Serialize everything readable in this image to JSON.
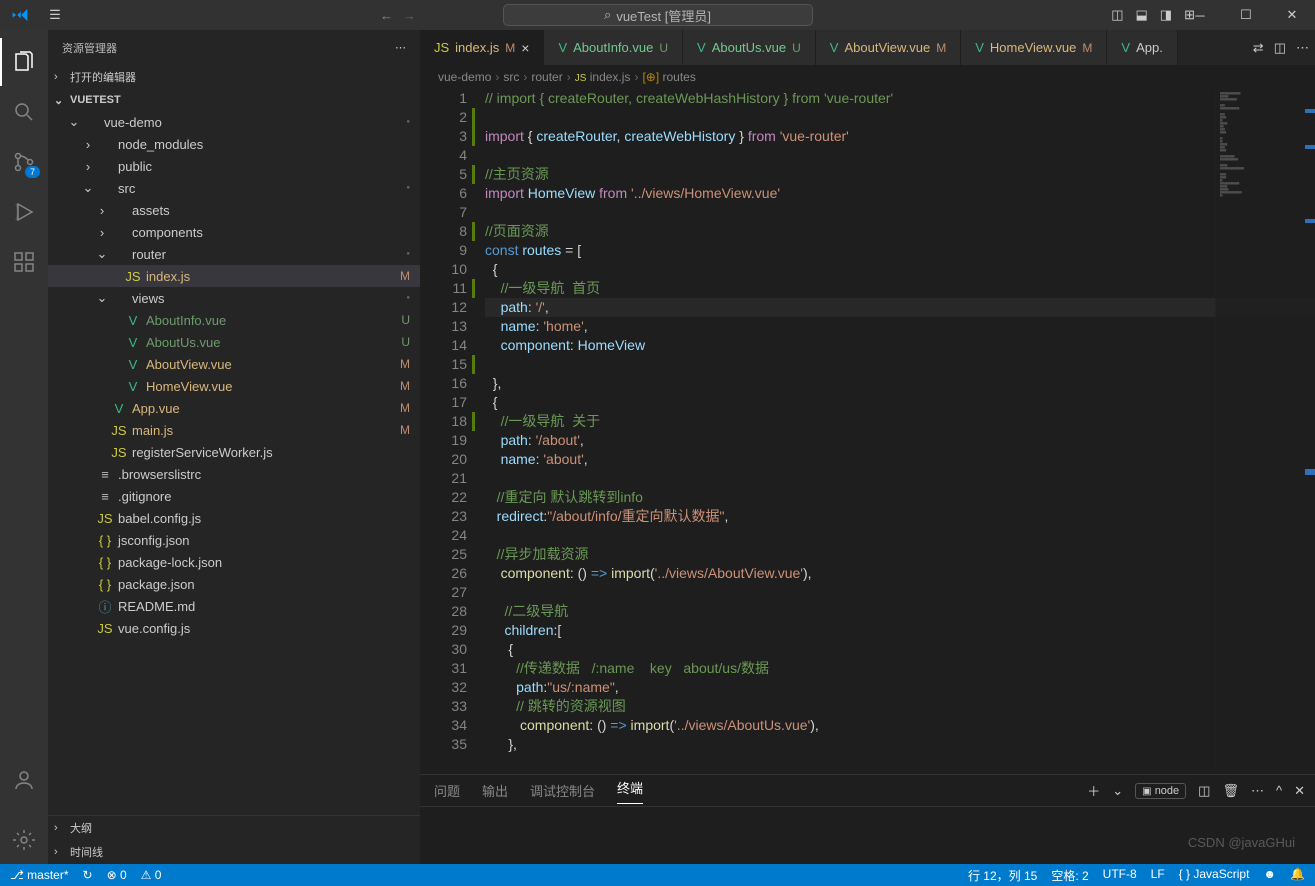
{
  "titlebar": {
    "search_prefix": "⌕",
    "search_text": "vueTest [管理员]"
  },
  "activity": {
    "scm_badge": "7"
  },
  "sidebar": {
    "title": "资源管理器",
    "open_editors": "打开的编辑器",
    "project": "VUETEST",
    "outline": "大纲",
    "timeline": "时间线",
    "tree": [
      {
        "d": 1,
        "tw": "v",
        "ic": "fold",
        "name": "vue-demo",
        "cls": "",
        "bc": "dot",
        "bv": "●"
      },
      {
        "d": 2,
        "tw": ">",
        "ic": "",
        "name": "node_modules",
        "cls": "",
        "bc": "",
        "bv": ""
      },
      {
        "d": 2,
        "tw": ">",
        "ic": "",
        "name": "public",
        "cls": "",
        "bc": "",
        "bv": ""
      },
      {
        "d": 2,
        "tw": "v",
        "ic": "",
        "name": "src",
        "cls": "",
        "bc": "dot",
        "bv": "●"
      },
      {
        "d": 3,
        "tw": ">",
        "ic": "",
        "name": "assets",
        "cls": "",
        "bc": "",
        "bv": ""
      },
      {
        "d": 3,
        "tw": ">",
        "ic": "",
        "name": "components",
        "cls": "",
        "bc": "",
        "bv": ""
      },
      {
        "d": 3,
        "tw": "v",
        "ic": "",
        "name": "router",
        "cls": "",
        "bc": "dot",
        "bv": "●"
      },
      {
        "d": 4,
        "tw": "",
        "ic": "js",
        "name": "index.js",
        "cls": "mod selected",
        "bc": "",
        "bv": "M"
      },
      {
        "d": 3,
        "tw": "v",
        "ic": "",
        "name": "views",
        "cls": "",
        "bc": "dot",
        "bv": "●"
      },
      {
        "d": 4,
        "tw": "",
        "ic": "vue",
        "name": "AboutInfo.vue",
        "cls": "unt",
        "bc": "u",
        "bv": "U"
      },
      {
        "d": 4,
        "tw": "",
        "ic": "vue",
        "name": "AboutUs.vue",
        "cls": "unt",
        "bc": "u",
        "bv": "U"
      },
      {
        "d": 4,
        "tw": "",
        "ic": "vue",
        "name": "AboutView.vue",
        "cls": "mod",
        "bc": "",
        "bv": "M"
      },
      {
        "d": 4,
        "tw": "",
        "ic": "vue",
        "name": "HomeView.vue",
        "cls": "mod",
        "bc": "",
        "bv": "M"
      },
      {
        "d": 3,
        "tw": "",
        "ic": "vue",
        "name": "App.vue",
        "cls": "mod",
        "bc": "",
        "bv": "M"
      },
      {
        "d": 3,
        "tw": "",
        "ic": "js",
        "name": "main.js",
        "cls": "mod",
        "bc": "",
        "bv": "M"
      },
      {
        "d": 3,
        "tw": "",
        "ic": "js",
        "name": "registerServiceWorker.js",
        "cls": "",
        "bc": "",
        "bv": ""
      },
      {
        "d": 2,
        "tw": "",
        "ic": "txt",
        "name": ".browserslistrc",
        "cls": "",
        "bc": "",
        "bv": ""
      },
      {
        "d": 2,
        "tw": "",
        "ic": "txt",
        "name": ".gitignore",
        "cls": "",
        "bc": "",
        "bv": ""
      },
      {
        "d": 2,
        "tw": "",
        "ic": "js",
        "name": "babel.config.js",
        "cls": "",
        "bc": "",
        "bv": ""
      },
      {
        "d": 2,
        "tw": "",
        "ic": "json",
        "name": "jsconfig.json",
        "cls": "",
        "bc": "",
        "bv": ""
      },
      {
        "d": 2,
        "tw": "",
        "ic": "json",
        "name": "package-lock.json",
        "cls": "",
        "bc": "",
        "bv": ""
      },
      {
        "d": 2,
        "tw": "",
        "ic": "json",
        "name": "package.json",
        "cls": "",
        "bc": "",
        "bv": ""
      },
      {
        "d": 2,
        "tw": "",
        "ic": "md",
        "name": "README.md",
        "cls": "",
        "bc": "",
        "bv": ""
      },
      {
        "d": 2,
        "tw": "",
        "ic": "js",
        "name": "vue.config.js",
        "cls": "",
        "bc": "",
        "bv": ""
      }
    ]
  },
  "tabs": [
    {
      "ic": "js",
      "name": "index.js",
      "status": "M",
      "active": true,
      "close": "×"
    },
    {
      "ic": "vue",
      "name": "AboutInfo.vue",
      "status": "U",
      "active": false
    },
    {
      "ic": "vue",
      "name": "AboutUs.vue",
      "status": "U",
      "active": false
    },
    {
      "ic": "vue",
      "name": "AboutView.vue",
      "status": "M",
      "active": false
    },
    {
      "ic": "vue",
      "name": "HomeView.vue",
      "status": "M",
      "active": false
    },
    {
      "ic": "vue",
      "name": "App.",
      "status": "",
      "active": false
    }
  ],
  "breadcrumb": [
    "vue-demo",
    "src",
    "router",
    "index.js",
    "routes"
  ],
  "code": [
    {
      "n": 1,
      "bar": 0,
      "html": "<span class='tk-c'>// import { createRouter, createWebHashHistory } from 'vue-router'</span>"
    },
    {
      "n": 2,
      "bar": 1,
      "html": ""
    },
    {
      "n": 3,
      "bar": 1,
      "html": "<span class='tk-k'>import</span> <span class='tk-p'>{</span> <span class='tk-v'>createRouter</span><span class='tk-p'>,</span> <span class='tk-v'>createWebHistory</span> <span class='tk-p'>}</span> <span class='tk-k'>from</span> <span class='tk-s'>'vue-router'</span>"
    },
    {
      "n": 4,
      "bar": 0,
      "html": ""
    },
    {
      "n": 5,
      "bar": 1,
      "html": "<span class='tk-c'>//主页资源</span>"
    },
    {
      "n": 6,
      "bar": 0,
      "html": "<span class='tk-k'>import</span> <span class='tk-v'>HomeView</span> <span class='tk-k'>from</span> <span class='tk-s'>'../views/HomeView.vue'</span>"
    },
    {
      "n": 7,
      "bar": 0,
      "html": ""
    },
    {
      "n": 8,
      "bar": 1,
      "html": "<span class='tk-c'>//页面资源</span>"
    },
    {
      "n": 9,
      "bar": 0,
      "html": "<span class='tk-a'>const</span> <span class='tk-v'>routes</span> <span class='tk-p'>=</span> <span class='tk-p'>[</span>"
    },
    {
      "n": 10,
      "bar": 0,
      "html": "  <span class='tk-p'>{</span>"
    },
    {
      "n": 11,
      "bar": 1,
      "html": "    <span class='tk-c'>//一级导航  首页</span>"
    },
    {
      "n": 12,
      "bar": 0,
      "cur": 1,
      "html": "    <span class='tk-v'>path</span><span class='tk-p'>:</span> <span class='tk-s'>'/'</span><span class='tk-p'>,</span>"
    },
    {
      "n": 13,
      "bar": 0,
      "html": "    <span class='tk-v'>name</span><span class='tk-p'>:</span> <span class='tk-s'>'home'</span><span class='tk-p'>,</span>"
    },
    {
      "n": 14,
      "bar": 0,
      "html": "    <span class='tk-v'>component</span><span class='tk-p'>:</span> <span class='tk-v'>HomeView</span>"
    },
    {
      "n": 15,
      "bar": 1,
      "html": ""
    },
    {
      "n": 16,
      "bar": 0,
      "html": "  <span class='tk-p'>},</span>"
    },
    {
      "n": 17,
      "bar": 0,
      "html": "  <span class='tk-p'>{</span>"
    },
    {
      "n": 18,
      "bar": 1,
      "html": "    <span class='tk-c'>//一级导航  关于</span>"
    },
    {
      "n": 19,
      "bar": 0,
      "html": "    <span class='tk-v'>path</span><span class='tk-p'>:</span> <span class='tk-s'>'/about'</span><span class='tk-p'>,</span>"
    },
    {
      "n": 20,
      "bar": 0,
      "html": "    <span class='tk-v'>name</span><span class='tk-p'>:</span> <span class='tk-s'>'about'</span><span class='tk-p'>,</span>"
    },
    {
      "n": 21,
      "bar": 0,
      "html": ""
    },
    {
      "n": 22,
      "bar": 0,
      "html": "   <span class='tk-c'>//重定向 默认跳转到info</span>"
    },
    {
      "n": 23,
      "bar": 0,
      "html": "   <span class='tk-v'>redirect</span><span class='tk-p'>:</span><span class='tk-s'>\"/about/info/重定向默认数据\"</span><span class='tk-p'>,</span>"
    },
    {
      "n": 24,
      "bar": 0,
      "html": ""
    },
    {
      "n": 25,
      "bar": 0,
      "html": "   <span class='tk-c'>//异步加载资源</span>"
    },
    {
      "n": 26,
      "bar": 0,
      "html": "    <span class='tk-f'>component</span><span class='tk-p'>:</span> <span class='tk-p'>()</span> <span class='tk-a'>=></span> <span class='tk-f'>import</span><span class='tk-p'>(</span><span class='tk-s'>'../views/AboutView.vue'</span><span class='tk-p'>),</span>"
    },
    {
      "n": 27,
      "bar": 0,
      "html": ""
    },
    {
      "n": 28,
      "bar": 0,
      "html": "     <span class='tk-c'>//二级导航</span>"
    },
    {
      "n": 29,
      "bar": 0,
      "html": "     <span class='tk-v'>children</span><span class='tk-p'>:[</span>"
    },
    {
      "n": 30,
      "bar": 0,
      "html": "      <span class='tk-p'>{</span>"
    },
    {
      "n": 31,
      "bar": 0,
      "html": "        <span class='tk-c'>//传递数据   /:name    key   about/us/数据</span>"
    },
    {
      "n": 32,
      "bar": 0,
      "html": "        <span class='tk-v'>path</span><span class='tk-p'>:</span><span class='tk-s'>\"us/:name\"</span><span class='tk-p'>,</span>"
    },
    {
      "n": 33,
      "bar": 0,
      "html": "        <span class='tk-c'>// 跳转的资源视图</span>"
    },
    {
      "n": 34,
      "bar": 0,
      "html": "         <span class='tk-f'>component</span><span class='tk-p'>:</span> <span class='tk-p'>()</span> <span class='tk-a'>=></span> <span class='tk-f'>import</span><span class='tk-p'>(</span><span class='tk-s'>'../views/AboutUs.vue'</span><span class='tk-p'>),</span>"
    },
    {
      "n": 35,
      "bar": 0,
      "html": "      <span class='tk-p'>},</span>"
    }
  ],
  "panel": {
    "tabs": [
      "问题",
      "输出",
      "调试控制台",
      "终端"
    ],
    "active": 3,
    "runner": "node"
  },
  "statusbar": {
    "branch": "master*",
    "sync": "↻",
    "errors": "⊗ 0",
    "warnings": "⚠ 0",
    "cursor": "行 12，列 15",
    "spaces": "空格: 2",
    "encoding": "UTF-8",
    "eol": "LF",
    "lang_ic": "{ }",
    "lang": "JavaScript"
  },
  "watermark": "CSDN @javaGHui"
}
